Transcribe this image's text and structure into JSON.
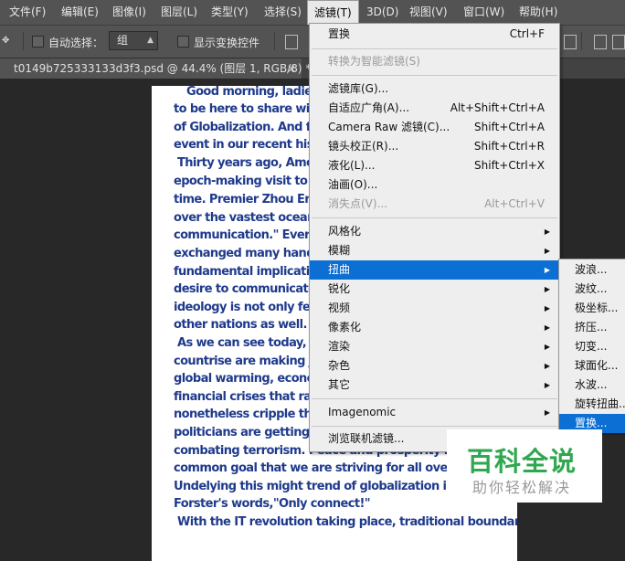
{
  "menubar": {
    "items": [
      "文件(F)",
      "编辑(E)",
      "图像(I)",
      "图层(L)",
      "类型(Y)",
      "选择(S)",
      "滤镜(T)",
      "3D(D)",
      "视图(V)",
      "窗口(W)",
      "帮助(H)"
    ]
  },
  "options": {
    "auto_select_label": "自动选择：",
    "auto_select_value": "组",
    "show_transform_label": "显示变换控件"
  },
  "document_tab": {
    "title": "t0149b725333133d3f3.psd @ 44.4% (图层 1, RGB/8) *",
    "close": "×"
  },
  "document_text": [
    "Good morning, ladies and",
    "to be here to share with yo",
    "of Globalization. And first c",
    "event in our recent history",
    "Thirty years ago, America",
    "epoch-making visit to Chin",
    "time. Premier Zhou Enlai sa",
    "over the vastest ocean in th",
    "communication.\" Ever sinc",
    "exchanged many handshak",
    "fundamental implication of",
    "desire to communicate acr",
    "ideology is not only felt but",
    "other nations as well.",
    "As we can see today, envi",
    "countrise are making joint",
    "global warming, economis",
    "financial crises that range",
    "nonetheless cripple the wo",
    "politicians are getting toge",
    "combating terrorism. Peace and prosperity has become",
    "common goal that we are striving for all over the world",
    "Undelying this might trend of globalization is the echo",
    "Forster's words,\"Only connect!\"",
    "With the IT revolution taking place, traditional boundaries of"
  ],
  "filter_menu": {
    "items": [
      {
        "label": "置换",
        "shortcut": "Ctrl+F",
        "disabled": false
      },
      {
        "label": "转换为智能滤镜(S)",
        "shortcut": "",
        "disabled": true
      },
      {
        "label": "滤镜库(G)...",
        "shortcut": "",
        "disabled": false
      },
      {
        "label": "自适应广角(A)...",
        "shortcut": "Alt+Shift+Ctrl+A",
        "disabled": false
      },
      {
        "label": "Camera Raw 滤镜(C)...",
        "shortcut": "Shift+Ctrl+A",
        "disabled": false
      },
      {
        "label": "镜头校正(R)...",
        "shortcut": "Shift+Ctrl+R",
        "disabled": false
      },
      {
        "label": "液化(L)...",
        "shortcut": "Shift+Ctrl+X",
        "disabled": false
      },
      {
        "label": "油画(O)...",
        "shortcut": "",
        "disabled": false
      },
      {
        "label": "消失点(V)...",
        "shortcut": "Alt+Ctrl+V",
        "disabled": true
      },
      {
        "label": "风格化",
        "submenu": true
      },
      {
        "label": "模糊",
        "submenu": true
      },
      {
        "label": "扭曲",
        "submenu": true,
        "highlighted": true
      },
      {
        "label": "锐化",
        "submenu": true
      },
      {
        "label": "视频",
        "submenu": true
      },
      {
        "label": "像素化",
        "submenu": true
      },
      {
        "label": "渲染",
        "submenu": true
      },
      {
        "label": "杂色",
        "submenu": true
      },
      {
        "label": "其它",
        "submenu": true
      },
      {
        "label": "Imagenomic",
        "submenu": true
      },
      {
        "label": "浏览联机滤镜..."
      }
    ]
  },
  "distort_submenu": {
    "items": [
      {
        "label": "波浪..."
      },
      {
        "label": "波纹..."
      },
      {
        "label": "极坐标..."
      },
      {
        "label": "挤压..."
      },
      {
        "label": "切变..."
      },
      {
        "label": "球面化..."
      },
      {
        "label": "水波..."
      },
      {
        "label": "旋转扭曲..."
      },
      {
        "label": "置换...",
        "highlighted": true
      }
    ]
  },
  "watermark": {
    "brand": "百科全说",
    "slogan": "助你轻松解决"
  },
  "colors": {
    "highlight": "#0b6fd3",
    "doc_text": "#1f3a8c",
    "watermark_green": "#2fa84f"
  }
}
